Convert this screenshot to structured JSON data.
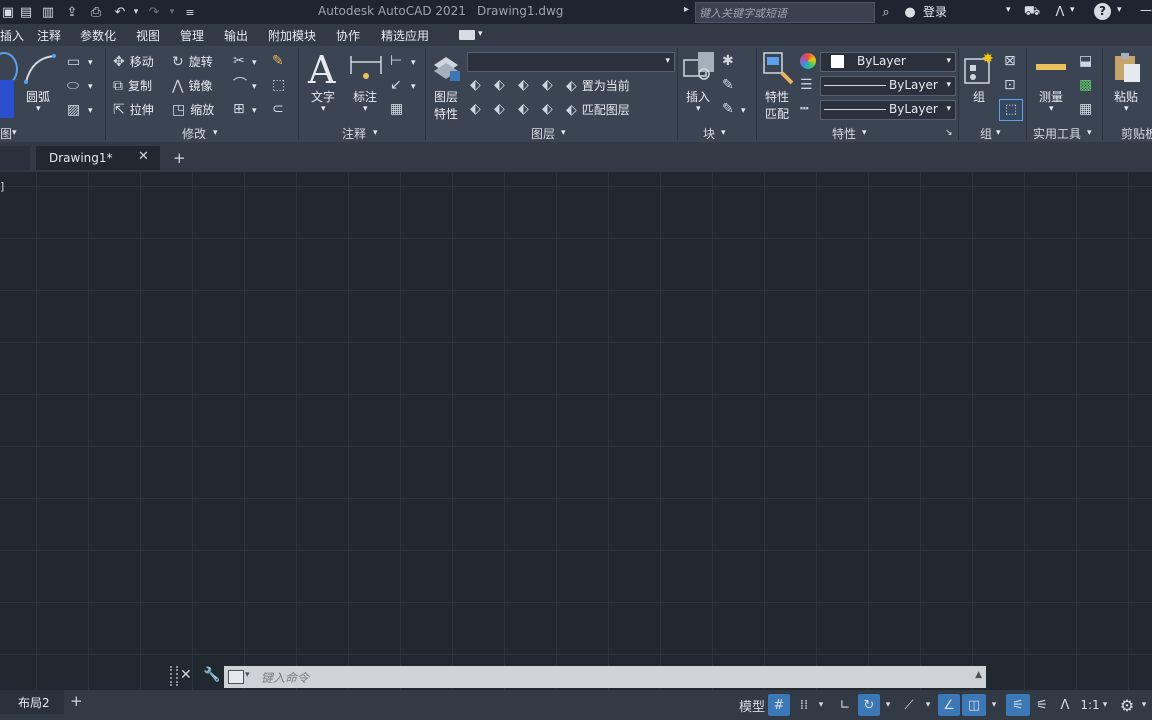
{
  "window": {
    "app_title": "Autodesk AutoCAD 2021",
    "file_title": "Drawing1.dwg",
    "search_placeholder": "键入关键字或短语",
    "login_label": "登录"
  },
  "menu": [
    "插入",
    "注释",
    "参数化",
    "视图",
    "管理",
    "输出",
    "附加模块",
    "协作",
    "精选应用"
  ],
  "ribbon": {
    "draw": {
      "arc_label": "圆弧",
      "panel_title": "图"
    },
    "modify": {
      "move": "移动",
      "rotate": "旋转",
      "copy": "复制",
      "mirror": "镜像",
      "stretch": "拉伸",
      "scale": "缩放",
      "panel_title": "修改"
    },
    "annotation": {
      "text": "文字",
      "dimension": "标注",
      "panel_title": "注释"
    },
    "layers": {
      "layer_props_line1": "图层",
      "layer_props_line2": "特性",
      "set_current": "置为当前",
      "match_layer": "匹配图层",
      "panel_title": "图层"
    },
    "block": {
      "insert": "插入",
      "panel_title": "块"
    },
    "properties": {
      "match_line1": "特性",
      "match_line2": "匹配",
      "color": "ByLayer",
      "linetype": "ByLayer",
      "lineweight": "ByLayer",
      "panel_title": "特性"
    },
    "groups": {
      "group": "组",
      "panel_title": "组"
    },
    "utilities": {
      "measure": "测量",
      "panel_title": "实用工具"
    },
    "clipboard": {
      "paste": "粘贴",
      "panel_title": "剪贴板"
    }
  },
  "tabs": {
    "drawing": "Drawing1*"
  },
  "command": {
    "placeholder": "键入命令"
  },
  "status": {
    "layout_tab": "布局2",
    "model": "模型",
    "scale": "1:1"
  },
  "colors": {
    "accent": "#3b78b5",
    "canvas": "#212830",
    "ribbon": "#3b4453"
  }
}
